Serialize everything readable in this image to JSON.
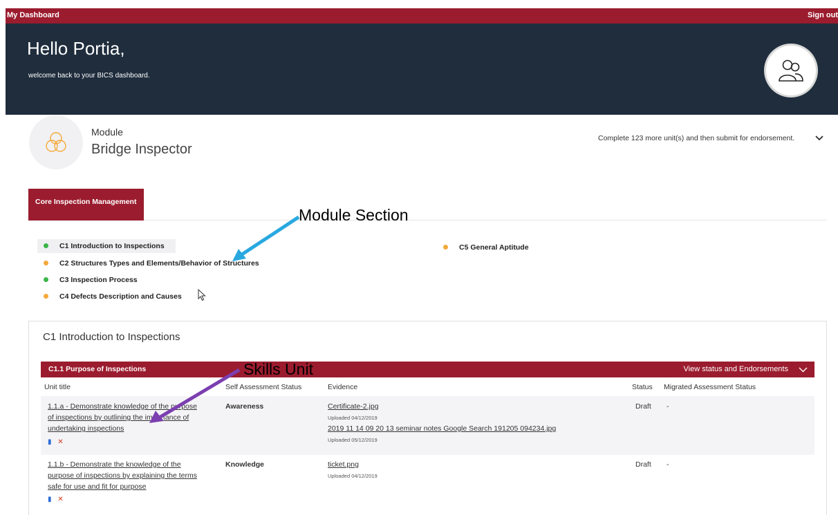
{
  "topbar": {
    "brand": "My Dashboard",
    "signout": "Sign out"
  },
  "hero": {
    "greeting": "Hello Portia,",
    "subtitle": "welcome back to your BICS dashboard."
  },
  "module": {
    "label": "Module",
    "name": "Bridge Inspector",
    "completion": "Complete 123 more unit(s) and then submit for endorsement."
  },
  "tab": {
    "label": "Core Inspection Management"
  },
  "callouts": {
    "module_section": "Module Section",
    "skills_unit": "Skills Unit"
  },
  "sections": [
    {
      "label": "C1 Introduction to Inspections",
      "status": "green",
      "active": true
    },
    {
      "label": "C2 Structures Types and Elements/Behavior of Structures",
      "status": "orange"
    },
    {
      "label": "C3 Inspection Process",
      "status": "green"
    },
    {
      "label": "C4 Defects Description and Causes",
      "status": "orange"
    },
    {
      "label": "C5 General Aptitude",
      "status": "orange"
    }
  ],
  "panel": {
    "title": "C1 Introduction to Inspections",
    "unit_header": {
      "title": "C1.1 Purpose of Inspections",
      "view_status": "View status and Endorsements"
    },
    "columns": [
      "Unit title",
      "Self Assessment Status",
      "Evidence",
      "Status",
      "Migrated Assessment Status"
    ],
    "rows": [
      {
        "title_lines": [
          "1.1.a - Demonstrate knowledge of the purpose",
          "of inspections by outlining the importance of",
          "undertaking inspections"
        ],
        "self_assessment": "Awareness",
        "evidence": [
          {
            "file": "Certificate-2.jpg",
            "uploaded": "Uploaded 04/12/2019"
          },
          {
            "file": "2019 11 14 09 20 13 seminar notes Google Search 191205 094234.jpg",
            "uploaded": "Uploaded 05/12/2019"
          }
        ],
        "status": "Draft",
        "migrated": "-"
      },
      {
        "title_lines": [
          "1.1.b - Demonstrate the knowledge of the",
          "purpose of inspections by explaining the terms",
          "safe for use and fit for purpose"
        ],
        "self_assessment": "Knowledge",
        "evidence": [
          {
            "file": "ticket.png",
            "uploaded": "Uploaded 04/12/2019"
          }
        ],
        "status": "Draft",
        "migrated": "-"
      }
    ],
    "action_icons": {
      "clip": "▮",
      "delete": "✕"
    }
  },
  "colors": {
    "brand": "#9b1c2e",
    "hero": "#1f2d3d",
    "green": "#3bb54a",
    "orange": "#f4a93b",
    "arrow_blue": "#29a8e0",
    "arrow_purple": "#7b3fb0"
  }
}
